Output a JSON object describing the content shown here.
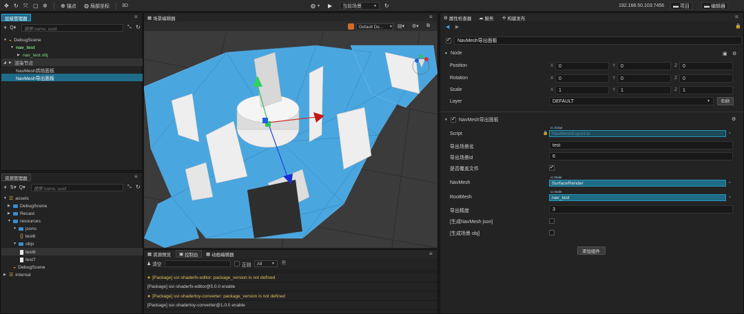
{
  "toolbar": {
    "pivot_label": "锚点",
    "local_label": "局部坐标",
    "mode_3d": "3D",
    "scene_label": "当前场景",
    "ip": "192.168.50.103:7456",
    "project_label": "项目",
    "editor_label": "编辑器"
  },
  "hierarchy": {
    "title": "层级管理器",
    "search_placeholder": "搜索 name, uuid",
    "items": [
      {
        "label": "DebugScene"
      },
      {
        "label": "nav_test"
      },
      {
        "label": "nav_test.obj"
      },
      {
        "label": "渲染节点"
      },
      {
        "label": "NavMesh烘焙面板"
      },
      {
        "label": "NavMesh导出面板"
      }
    ]
  },
  "assets": {
    "title": "资源管理器",
    "search_placeholder": "搜索 name, uuid",
    "items": [
      {
        "label": "assets"
      },
      {
        "label": "DebugScene"
      },
      {
        "label": "Recast"
      },
      {
        "label": "resources"
      },
      {
        "label": "jsons"
      },
      {
        "label": "test6"
      },
      {
        "label": "objs"
      },
      {
        "label": "test6"
      },
      {
        "label": "test7"
      },
      {
        "label": "DebugScene"
      },
      {
        "label": "internal"
      }
    ]
  },
  "scene": {
    "title": "场景编辑器",
    "camera_select": "Default De..."
  },
  "console": {
    "tabs": [
      "资源预览",
      "控制台",
      "动画编辑器"
    ],
    "clear_label": "清空",
    "regex_label": "正则",
    "filter_value": "All",
    "lines": [
      {
        "type": "warn",
        "text": "[Package] ssr-shaderfx-editor: package_version is not defined"
      },
      {
        "type": "info",
        "text": "[Package] ssr-shaderfx-editor@5.0.0 enable"
      },
      {
        "type": "warn",
        "text": "[Package] ssr-shadertoy-converter: package_version is not defined"
      },
      {
        "type": "info",
        "text": "[Package] ssr-shadertoy-converter@1.0.0 enable"
      }
    ]
  },
  "inspector": {
    "tabs": [
      "属性检查器",
      "服务",
      "构建发布"
    ],
    "node_name": "NavMesh导出面板",
    "node_section": "Node",
    "position": {
      "label": "Position",
      "x": "0",
      "y": "0",
      "z": "0"
    },
    "rotation": {
      "label": "Rotation",
      "x": "0",
      "y": "0",
      "z": "0"
    },
    "scale": {
      "label": "Scale",
      "x": "1",
      "y": "1",
      "z": "1"
    },
    "layer": {
      "label": "Layer",
      "value": "DEFAULT",
      "edit": "Edit"
    },
    "component_title": "NavMesh导出面板",
    "script": {
      "label": "Script",
      "type": "cc.Script",
      "value": "NavMeshExport.ts"
    },
    "export_name": {
      "label": "导出场景名",
      "value": "test"
    },
    "export_id": {
      "label": "导出场景id",
      "value": "6"
    },
    "overwrite": {
      "label": "是否覆盖文件"
    },
    "navmesh": {
      "label": "NavMesh",
      "type": "cc.Node",
      "value": "SurfaceRender"
    },
    "rootmesh": {
      "label": "RootMesh",
      "type": "cc.Node",
      "value": "nav_test"
    },
    "precision": {
      "label": "导出精度",
      "value": "3"
    },
    "gen_json": {
      "label": "[生成NavMesh json]"
    },
    "gen_obj": {
      "label": "[生成场景 obj]"
    },
    "add_component": "添加组件"
  },
  "colors": {
    "accent": "#1f6b8a",
    "selection": "#1f6b8a",
    "mesh": "#4aa6df"
  }
}
